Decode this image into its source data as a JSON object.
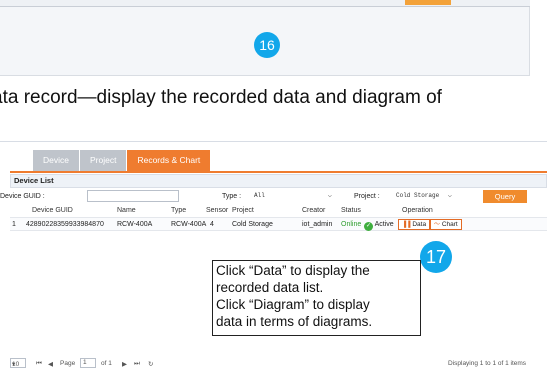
{
  "prev_step": {
    "badge": "16"
  },
  "caption": "ata record—display the recorded data and diagram of",
  "tabs": [
    {
      "label": "Device",
      "active": false
    },
    {
      "label": "Project",
      "active": false
    },
    {
      "label": "Records & Chart",
      "active": true
    }
  ],
  "panel_title": "Device List",
  "filters": {
    "guid_label": "Device GUID :",
    "guid_value": "",
    "type_label": "Type :",
    "type_value": "All",
    "project_label": "Project :",
    "project_value": "Cold Storage",
    "query_label": "Query"
  },
  "columns": [
    "Device GUID",
    "Name",
    "Type",
    "Sensor",
    "Project",
    "Creator",
    "Status",
    "Operation"
  ],
  "rows": [
    {
      "index": "1",
      "guid": "42890228359933984870",
      "name": "RCW-400A",
      "type": "RCW-400A",
      "sensor": "4",
      "project": "Cold Storage",
      "creator": "iot_admin",
      "online": "Online",
      "active": "Active",
      "data_btn": "Data",
      "chart_btn": "Chart"
    }
  ],
  "step": {
    "badge": "17"
  },
  "callout": [
    "Click “Data” to display the",
    "recorded data list.",
    "Click “Diagram” to display",
    "data in terms of diagrams."
  ],
  "pager": {
    "page_size": "10",
    "page_label": "Page",
    "page_value": "1",
    "of_label": "of 1",
    "display_text": "Displaying 1 to 1 of 1 items"
  },
  "colors": {
    "accent": "#ef7c2f",
    "badge": "#12a7ea",
    "online": "#3fae3f"
  }
}
